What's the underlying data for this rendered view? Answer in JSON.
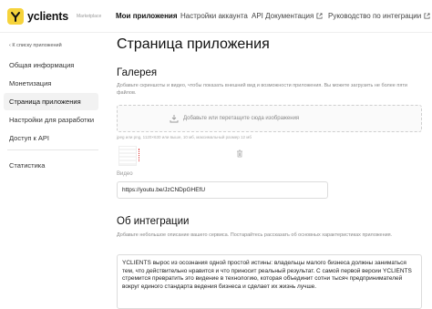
{
  "header": {
    "brand": "yclients",
    "brand_sub": "Marketplace",
    "nav": [
      {
        "label": "Мои приложения",
        "active": true
      },
      {
        "label": "Настройки аккаунта",
        "active": false
      },
      {
        "label": "API Документация",
        "active": false,
        "external": true
      },
      {
        "label": "Руководство по интеграции",
        "active": false,
        "external": true
      }
    ]
  },
  "sidebar": {
    "back_label": "К списку приложений",
    "items": [
      {
        "label": "Общая информация",
        "active": false
      },
      {
        "label": "Монетизация",
        "active": false
      },
      {
        "label": "Страница приложения",
        "active": true
      },
      {
        "label": "Настройки для разработки",
        "active": false
      },
      {
        "label": "Доступ к API",
        "active": false
      }
    ],
    "extra_items": [
      {
        "label": "Статистика",
        "active": false
      }
    ]
  },
  "main": {
    "title": "Страница приложения",
    "gallery": {
      "heading": "Галерея",
      "description": "Добавьте скриншоты и видео, чтобы показать внешний вид и возможности приложения. Вы можете загрузить не более пяти файлов.",
      "dropzone_label": "Добавьте или перетащите сюда изображения",
      "hint": "jpeg или png, 1120×630 или выше, 10 мб, максимальный размер 12 мб"
    },
    "video": {
      "label": "Видео",
      "value": "https://youtu.be/JzCNDpGHEfU"
    },
    "about": {
      "heading": "Об интеграции",
      "description": "Добавьте небольшое описание вашего сервиса. Постарайтесь рассказать об основных характеристиках приложения.",
      "text": "YCLIENTS вырос из осознания одной простой истины: владельцы малого бизнеса должны заниматься тем, что действительно нравится и что приносит реальный результат. С самой первой версии YCLIENTS стремится превратить это видение в технологию, которая объединит сотни тысяч предпринимателей вокруг единого стандарта ведения бизнеса и сделает их жизнь лучше."
    }
  },
  "colors": {
    "brand_yellow": "#f6d33b",
    "active_bg": "#f2f2f2",
    "text_muted": "#888888"
  }
}
